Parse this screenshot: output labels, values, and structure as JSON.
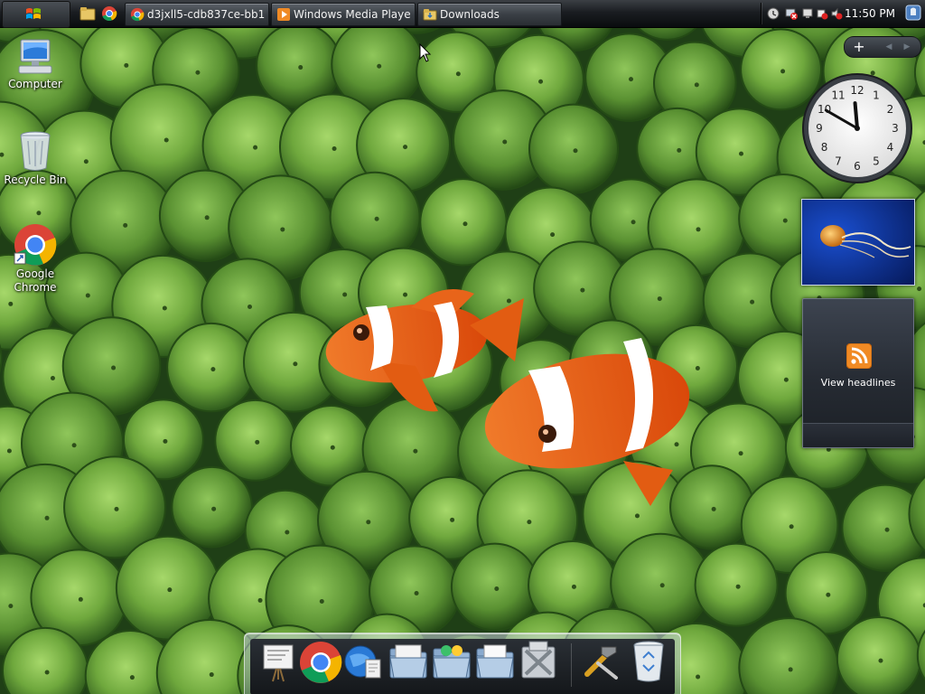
{
  "taskbar": {
    "start_label": "Start",
    "quicklaunch": [
      {
        "icon": "explorer-folder-icon"
      },
      {
        "icon": "chrome-icon"
      }
    ],
    "tasks": [
      {
        "label": "d3jxll5-cdb837ce-bb1d...",
        "icon": "chrome-icon"
      },
      {
        "label": "Windows Media Player",
        "icon": "media-player-icon"
      },
      {
        "label": "Downloads",
        "icon": "folder-icon"
      }
    ],
    "tray": {
      "icons": [
        "help-icon",
        "network-error-icon",
        "display-icon",
        "power-icon",
        "volume-muted-icon"
      ],
      "time": "11:50 PM"
    },
    "show_desktop_icon": "show-desktop-icon"
  },
  "desktop": {
    "icons": [
      {
        "label": "Computer",
        "icon": "computer-icon"
      },
      {
        "label": "Recycle Bin",
        "icon": "recycle-bin-icon"
      },
      {
        "label": "Google Chrome",
        "icon": "chrome-icon"
      }
    ]
  },
  "sidebar": {
    "controls": {
      "add": "+",
      "prev": "◀",
      "next": "▶"
    },
    "clock": {
      "hour": 11,
      "minute": 50
    },
    "feed": {
      "label": "View headlines",
      "icon": "rss-icon"
    }
  },
  "dock": {
    "items": [
      {
        "icon": "presentation-icon"
      },
      {
        "icon": "chrome-icon"
      },
      {
        "icon": "globe-documents-icon"
      },
      {
        "icon": "folder-icon"
      },
      {
        "icon": "applications-folder-icon"
      },
      {
        "icon": "documents-folder-icon"
      },
      {
        "icon": "utilities-icon"
      },
      {
        "icon": "tools-icon"
      },
      {
        "icon": "recycle-bin-icon"
      }
    ]
  },
  "colors": {
    "wallpaper_green": "#6fa83d",
    "anemone_dark": "#1f3f16",
    "clownfish_orange": "#ea5a0f",
    "taskbar": "#1a1d21",
    "rss_orange": "#f08a24"
  }
}
